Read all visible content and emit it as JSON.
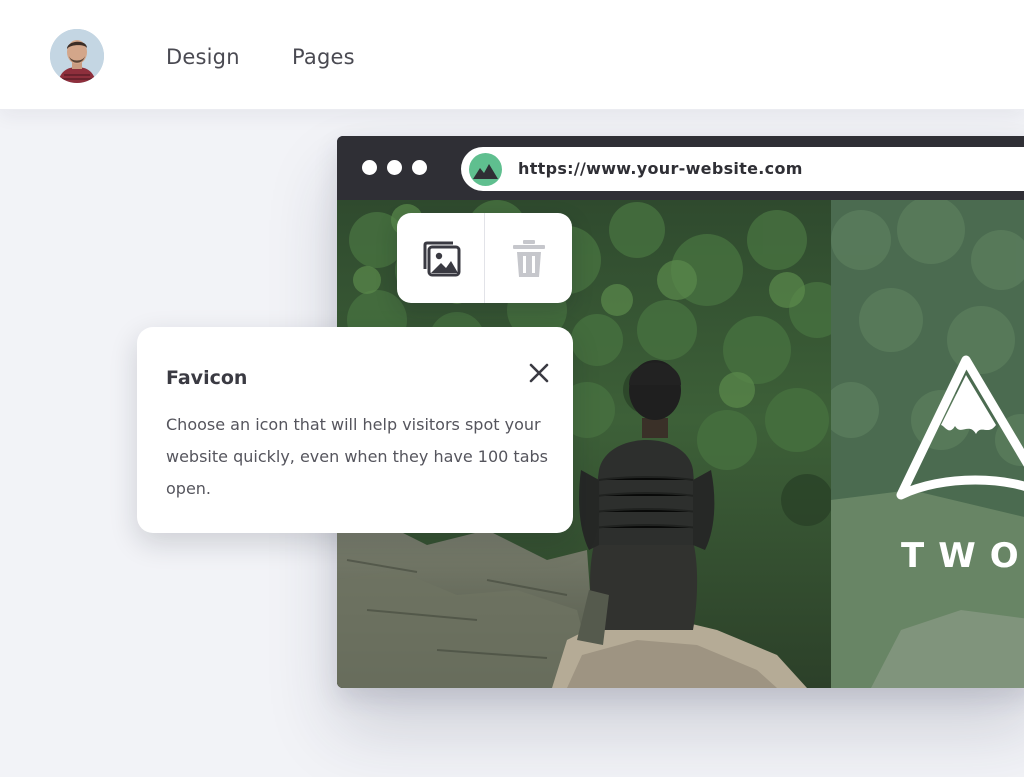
{
  "nav": {
    "items": [
      {
        "label": "Design"
      },
      {
        "label": "Pages"
      }
    ]
  },
  "browser": {
    "url": "https://www.your-website.com",
    "hero_text": "TWO"
  },
  "toolbar": {
    "image_icon": "image-icon",
    "delete_icon": "trash-icon"
  },
  "tooltip": {
    "title": "Favicon",
    "body": "Choose an icon that will help visitors spot your website quickly, even when they have 100 tabs open."
  },
  "colors": {
    "background": "#f2f3f7",
    "browser_chrome": "#2f2f35",
    "favicon_green": "#5fbf8f",
    "text_dark": "#3a3a42"
  }
}
